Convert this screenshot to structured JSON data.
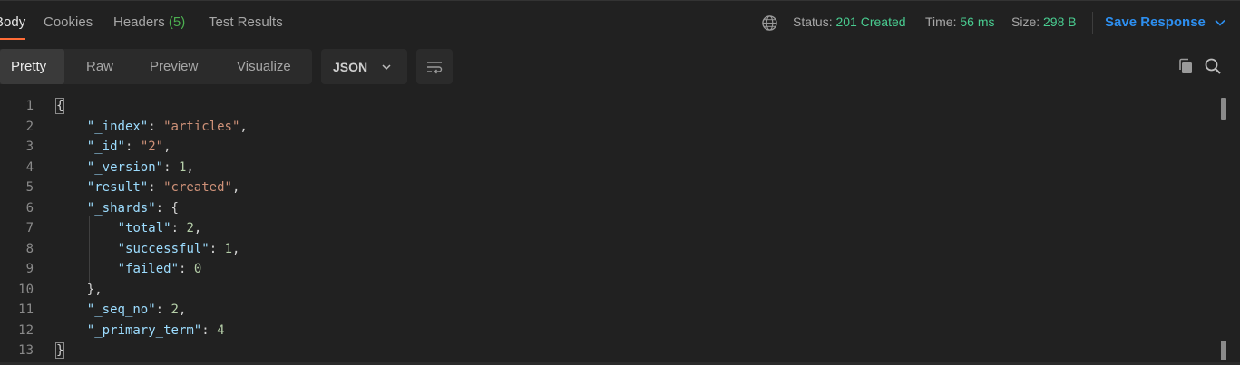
{
  "tabs": {
    "body": "Body",
    "cookies": "Cookies",
    "headers": "Headers",
    "headers_count": "(5)",
    "test_results": "Test Results"
  },
  "response_meta": {
    "status_label": "Status:",
    "status_value": "201 Created",
    "time_label": "Time:",
    "time_value": "56 ms",
    "size_label": "Size:",
    "size_value": "298 B",
    "save_label": "Save Response"
  },
  "view_modes": [
    "Pretty",
    "Raw",
    "Preview",
    "Visualize"
  ],
  "active_mode": "Pretty",
  "format": "JSON",
  "colors": {
    "accent_tab": "#ff6c37",
    "status_ok": "#49cc90",
    "link_blue": "#2d8ff0",
    "json_key": "#9cdcfe",
    "json_string": "#ce9178",
    "json_number": "#b5cea8"
  },
  "icons": {
    "globe": "globe-icon",
    "chevron": "chevron-down-icon",
    "wrap": "word-wrap-icon",
    "copy": "copy-icon",
    "search": "search-icon"
  },
  "editor": {
    "line_numbers": [
      "1",
      "2",
      "3",
      "4",
      "5",
      "6",
      "7",
      "8",
      "9",
      "10",
      "11",
      "12",
      "13"
    ],
    "lines": [
      [
        {
          "t": "punc",
          "v": "{"
        }
      ],
      [
        {
          "t": "key",
          "v": "\"_index\""
        },
        {
          "t": "punc",
          "v": ": "
        },
        {
          "t": "str",
          "v": "\"articles\""
        },
        {
          "t": "punc",
          "v": ","
        }
      ],
      [
        {
          "t": "key",
          "v": "\"_id\""
        },
        {
          "t": "punc",
          "v": ": "
        },
        {
          "t": "str",
          "v": "\"2\""
        },
        {
          "t": "punc",
          "v": ","
        }
      ],
      [
        {
          "t": "key",
          "v": "\"_version\""
        },
        {
          "t": "punc",
          "v": ": "
        },
        {
          "t": "num",
          "v": "1"
        },
        {
          "t": "punc",
          "v": ","
        }
      ],
      [
        {
          "t": "key",
          "v": "\"result\""
        },
        {
          "t": "punc",
          "v": ": "
        },
        {
          "t": "str",
          "v": "\"created\""
        },
        {
          "t": "punc",
          "v": ","
        }
      ],
      [
        {
          "t": "key",
          "v": "\"_shards\""
        },
        {
          "t": "punc",
          "v": ": {"
        }
      ],
      [
        {
          "t": "key",
          "v": "\"total\""
        },
        {
          "t": "punc",
          "v": ": "
        },
        {
          "t": "num",
          "v": "2"
        },
        {
          "t": "punc",
          "v": ","
        }
      ],
      [
        {
          "t": "key",
          "v": "\"successful\""
        },
        {
          "t": "punc",
          "v": ": "
        },
        {
          "t": "num",
          "v": "1"
        },
        {
          "t": "punc",
          "v": ","
        }
      ],
      [
        {
          "t": "key",
          "v": "\"failed\""
        },
        {
          "t": "punc",
          "v": ": "
        },
        {
          "t": "num",
          "v": "0"
        }
      ],
      [
        {
          "t": "punc",
          "v": "},"
        }
      ],
      [
        {
          "t": "key",
          "v": "\"_seq_no\""
        },
        {
          "t": "punc",
          "v": ": "
        },
        {
          "t": "num",
          "v": "2"
        },
        {
          "t": "punc",
          "v": ","
        }
      ],
      [
        {
          "t": "key",
          "v": "\"_primary_term\""
        },
        {
          "t": "punc",
          "v": ": "
        },
        {
          "t": "num",
          "v": "4"
        }
      ],
      [
        {
          "t": "punc",
          "v": "}"
        }
      ]
    ]
  }
}
